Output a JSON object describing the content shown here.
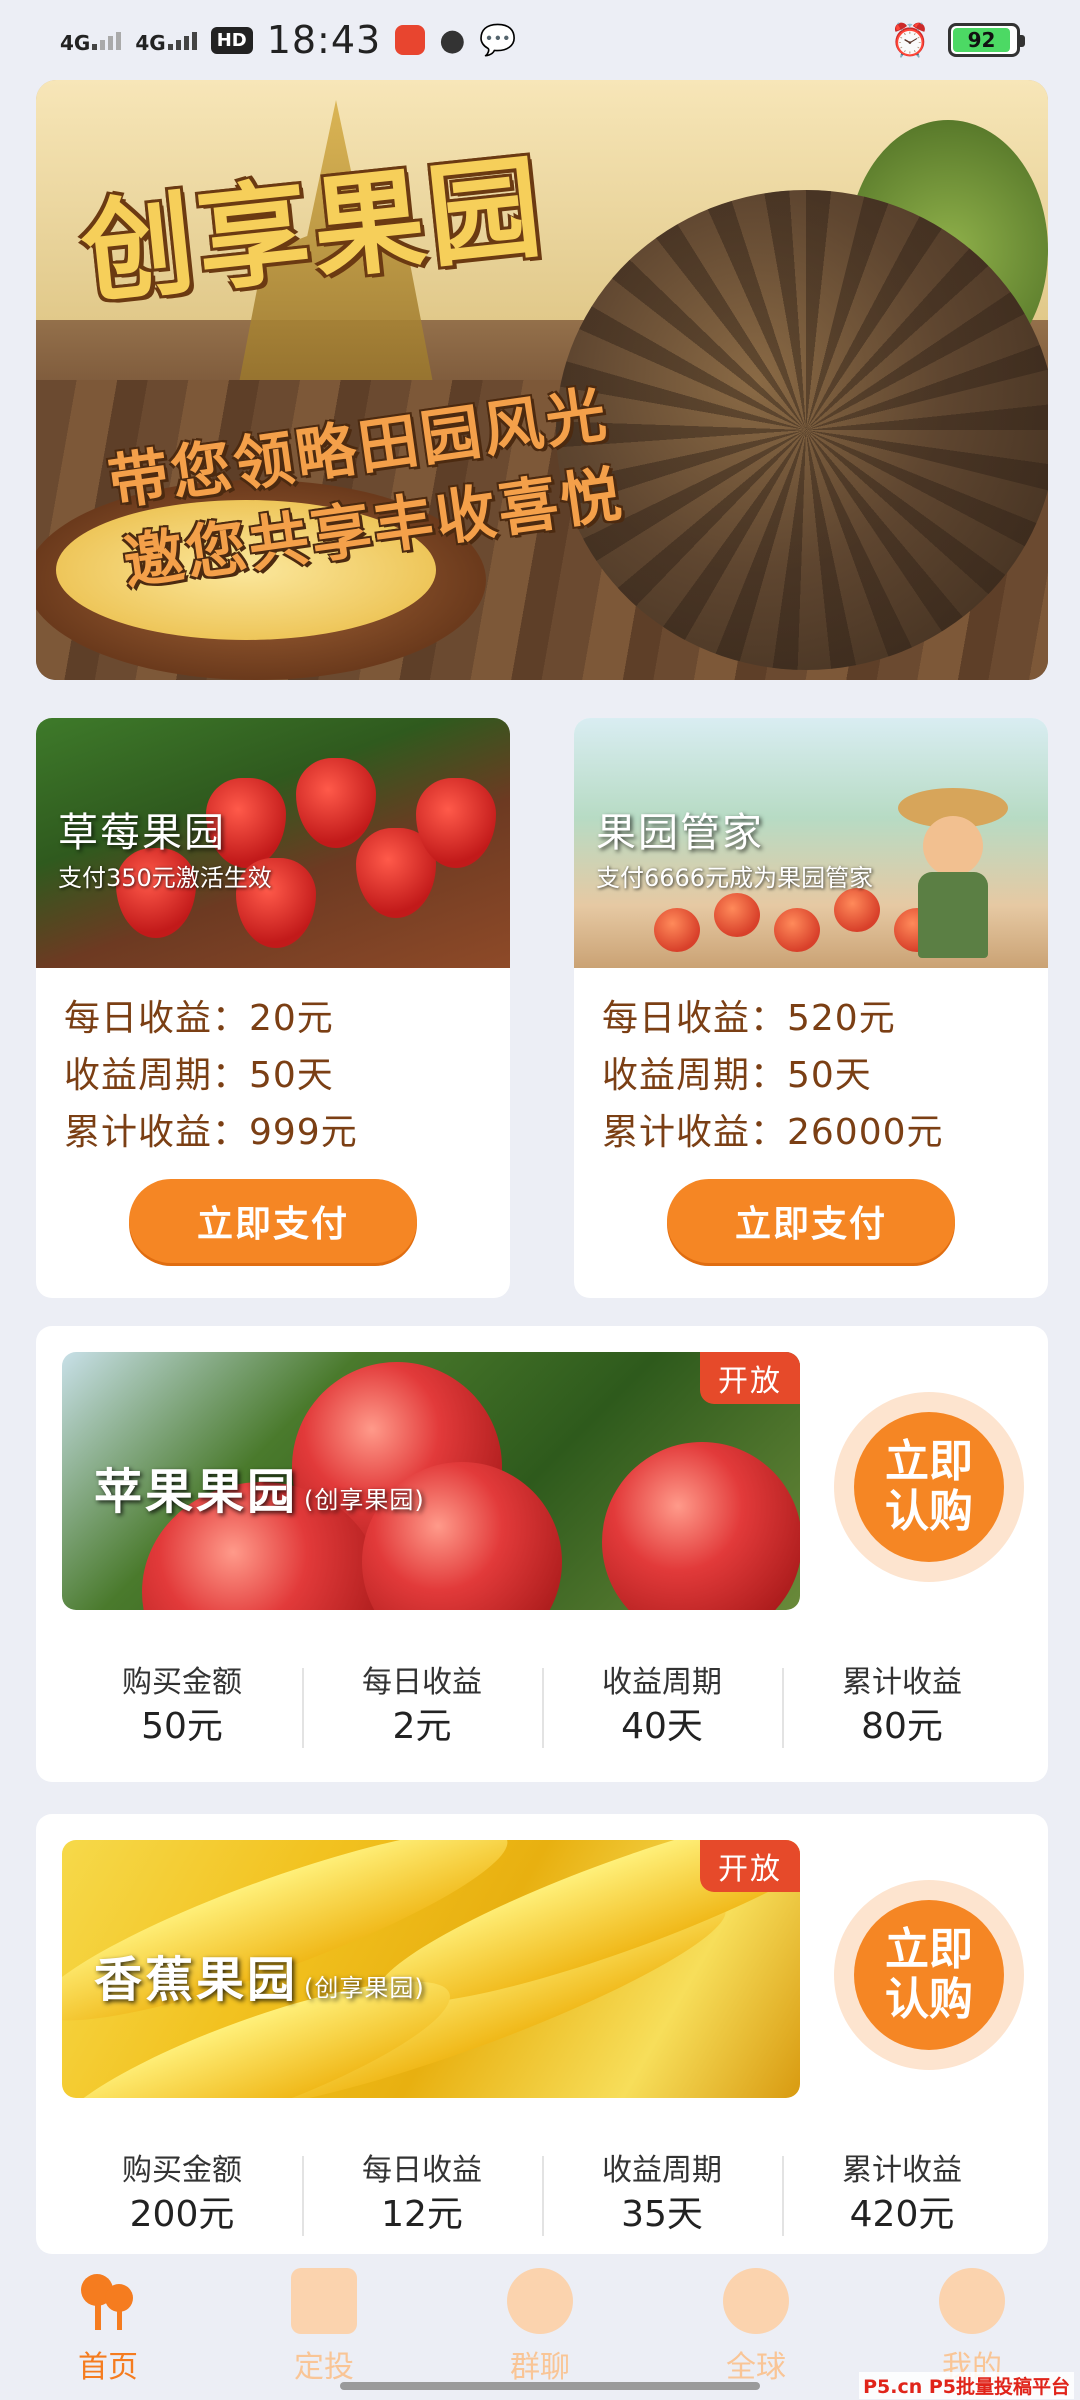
{
  "status_bar": {
    "net1": "4G",
    "net2": "4G",
    "hd": "HD",
    "time": "18:43",
    "battery": "92"
  },
  "banner": {
    "title": "创享果园",
    "line1": "带您领略田园风光",
    "line2": "邀您共享丰收喜悦"
  },
  "featured": [
    {
      "title": "草莓果园",
      "desc": "支付350元激活生效",
      "daily": "每日收益：20元",
      "period": "收益周期：50天",
      "total": "累计收益：999元",
      "button": "立即支付"
    },
    {
      "title": "果园管家",
      "desc": "支付6666元成为果园管家",
      "daily": "每日收益：520元",
      "period": "收益周期：50天",
      "total": "累计收益：26000元",
      "button": "立即支付"
    }
  ],
  "products": [
    {
      "name": "苹果果园",
      "sub": "(创享果园)",
      "tag": "开放",
      "buy_label": "立即认购",
      "stats": [
        {
          "k": "购买金额",
          "v": "50元"
        },
        {
          "k": "每日收益",
          "v": "2元"
        },
        {
          "k": "收益周期",
          "v": "40天"
        },
        {
          "k": "累计收益",
          "v": "80元"
        }
      ]
    },
    {
      "name": "香蕉果园",
      "sub": "(创享果园)",
      "tag": "开放",
      "buy_label": "立即认购",
      "stats": [
        {
          "k": "购买金额",
          "v": "200元"
        },
        {
          "k": "每日收益",
          "v": "12元"
        },
        {
          "k": "收益周期",
          "v": "35天"
        },
        {
          "k": "累计收益",
          "v": "420元"
        }
      ]
    }
  ],
  "nav": [
    {
      "label": "首页",
      "icon": "tree-icon"
    },
    {
      "label": "定投",
      "icon": "calendar-icon"
    },
    {
      "label": "群聊",
      "icon": "chat-icon"
    },
    {
      "label": "全球",
      "icon": "globe-icon"
    },
    {
      "label": "我的",
      "icon": "user-icon"
    }
  ],
  "watermark": "P5.cn P5批量投稿平台",
  "colors": {
    "accent": "#f58624",
    "tag": "#e64a2a",
    "stat_text": "#7b3f14",
    "background": "#eceef5"
  }
}
